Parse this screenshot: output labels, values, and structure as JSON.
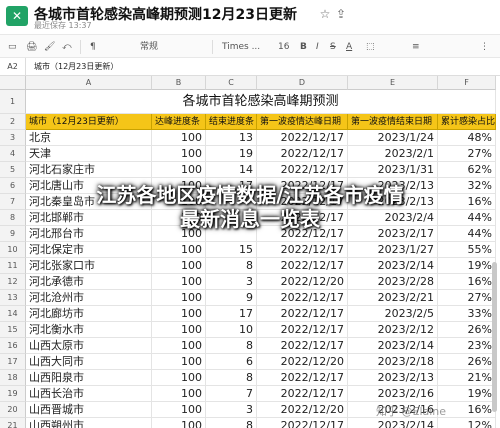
{
  "app": {
    "logo_glyph": "✕",
    "doc_title": "各城市首轮感染高峰期预测12月23日更新",
    "save_status": "最近保存 13:37",
    "accent": "#21a366"
  },
  "toolbar": {
    "items": [
      "▭",
      "🖨",
      "🖌",
      "⤺",
      "¶",
      "常规",
      "Times ...",
      "16",
      "B",
      "I",
      "S",
      "A",
      "⬚",
      "≡",
      "⋮"
    ]
  },
  "formula_bar": {
    "cell_ref": "A2",
    "content": "城市（12月23日更新）"
  },
  "columns": [
    "A",
    "B",
    "C",
    "D",
    "E",
    "F"
  ],
  "header_color": "#f5c518",
  "sheet": {
    "title": "各城市首轮感染高峰期预测",
    "headers": [
      "城市（12月23日更新）",
      "达峰进度条",
      "结束进度条",
      "第一波疫情达峰日期",
      "第一波疫情结束日期",
      "累计感染占比"
    ],
    "rows": [
      [
        "北京",
        "100",
        "13",
        "2022/12/17",
        "2023/1/24",
        "48%"
      ],
      [
        "天津",
        "100",
        "19",
        "2022/12/17",
        "2023/2/1",
        "27%"
      ],
      [
        "河北石家庄市",
        "100",
        "14",
        "2022/12/17",
        "2023/1/31",
        "62%"
      ],
      [
        "河北唐山市",
        "100",
        "17",
        "2022/12/17",
        "2023/2/13",
        "32%"
      ],
      [
        "河北秦皇岛市",
        "100",
        "",
        "2022/12/17",
        "2023/2/13",
        "16%"
      ],
      [
        "河北邯郸市",
        "100",
        "",
        "2022/12/17",
        "2023/2/4",
        "44%"
      ],
      [
        "河北邢台市",
        "100",
        "",
        "2022/12/17",
        "2023/2/17",
        "44%"
      ],
      [
        "河北保定市",
        "100",
        "15",
        "2022/12/17",
        "2023/1/27",
        "55%"
      ],
      [
        "河北张家口市",
        "100",
        "8",
        "2022/12/17",
        "2023/2/14",
        "19%"
      ],
      [
        "河北承德市",
        "100",
        "3",
        "2022/12/20",
        "2023/2/28",
        "16%"
      ],
      [
        "河北沧州市",
        "100",
        "9",
        "2022/12/17",
        "2023/2/21",
        "27%"
      ],
      [
        "河北廊坊市",
        "100",
        "17",
        "2022/12/17",
        "2023/2/5",
        "33%"
      ],
      [
        "河北衡水市",
        "100",
        "10",
        "2022/12/17",
        "2023/2/12",
        "26%"
      ],
      [
        "山西太原市",
        "100",
        "8",
        "2022/12/17",
        "2023/2/14",
        "23%"
      ],
      [
        "山西大同市",
        "100",
        "6",
        "2022/12/20",
        "2023/2/18",
        "26%"
      ],
      [
        "山西阳泉市",
        "100",
        "8",
        "2022/12/17",
        "2023/2/13",
        "21%"
      ],
      [
        "山西长治市",
        "100",
        "7",
        "2022/12/17",
        "2023/2/16",
        "19%"
      ],
      [
        "山西晋城市",
        "100",
        "3",
        "2022/12/20",
        "2023/2/16",
        "16%"
      ],
      [
        "山西朔州市",
        "100",
        "8",
        "2022/12/17",
        "2023/2/14",
        "12%"
      ]
    ]
  },
  "overlay": {
    "line1": "江苏各地区疫情数据/江苏各市疫情",
    "line2": "最新消息一览表"
  },
  "watermark": "知乎 @Elaine"
}
